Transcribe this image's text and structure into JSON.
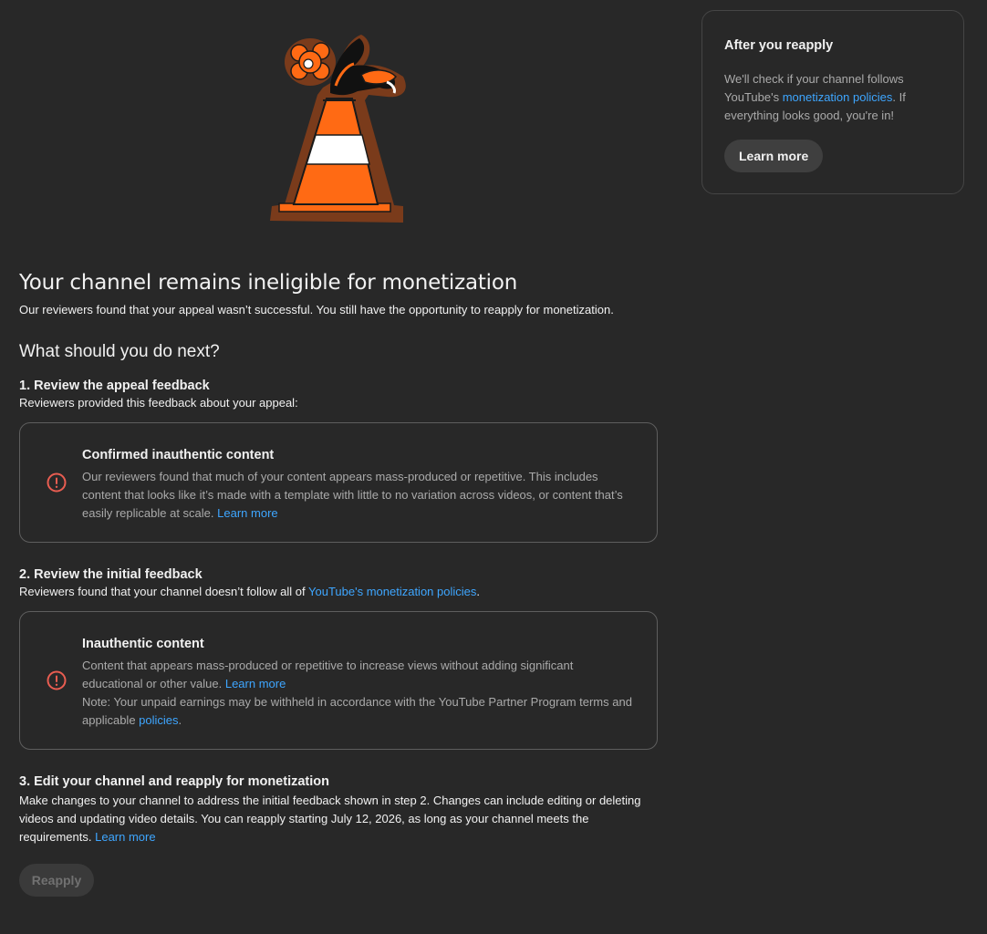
{
  "main": {
    "title": "Your channel remains ineligible for monetization",
    "subtitle": "Our reviewers found that your appeal wasn’t successful. You still have the opportunity to reapply for monetization.",
    "next_heading": "What should you do next?",
    "step1": {
      "title": "1. Review the appeal feedback",
      "desc": "Reviewers provided this feedback about your appeal:",
      "card": {
        "title": "Confirmed inauthentic content",
        "body": "Our reviewers found that much of your content appears mass-produced or repetitive. This includes content that looks like it’s made with a template with little to no variation across videos, or content that’s easily replicable at scale.",
        "link": "Learn more"
      }
    },
    "step2": {
      "title": "2. Review the initial feedback",
      "desc_prefix": "Reviewers found that your channel doesn’t follow all of ",
      "desc_link": "YouTube's monetization policies",
      "desc_suffix": ".",
      "card": {
        "title": "Inauthentic content",
        "body": "Content that appears mass-produced or repetitive to increase views without adding significant educational or other value.",
        "link": "Learn more",
        "note_prefix": "Note: Your unpaid earnings may be withheld in accordance with the YouTube Partner Program terms and applicable ",
        "note_link": "policies",
        "note_suffix": "."
      }
    },
    "step3": {
      "title": "3. Edit your channel and reapply for monetization",
      "desc": "Make changes to your channel to address the initial feedback shown in step 2. Changes can include editing or deleting videos and updating video details. You can reapply starting July 12, 2026, as long as your channel meets the requirements.",
      "link": "Learn more"
    },
    "reapply_label": "Reapply"
  },
  "side": {
    "title": "After you reapply",
    "body_prefix": "We'll check if your channel follows YouTube's ",
    "body_link": "monetization policies",
    "body_suffix": ". If everything looks good, you're in!",
    "button_label": "Learn more"
  },
  "colors": {
    "background": "#282828",
    "link": "#3ea6ff",
    "alert": "#e95d51",
    "cone_orange": "#ff6a14"
  },
  "icons": {
    "illustration": "traffic-cone-with-flower-illustration",
    "card_alert": "alert-circle-icon"
  }
}
